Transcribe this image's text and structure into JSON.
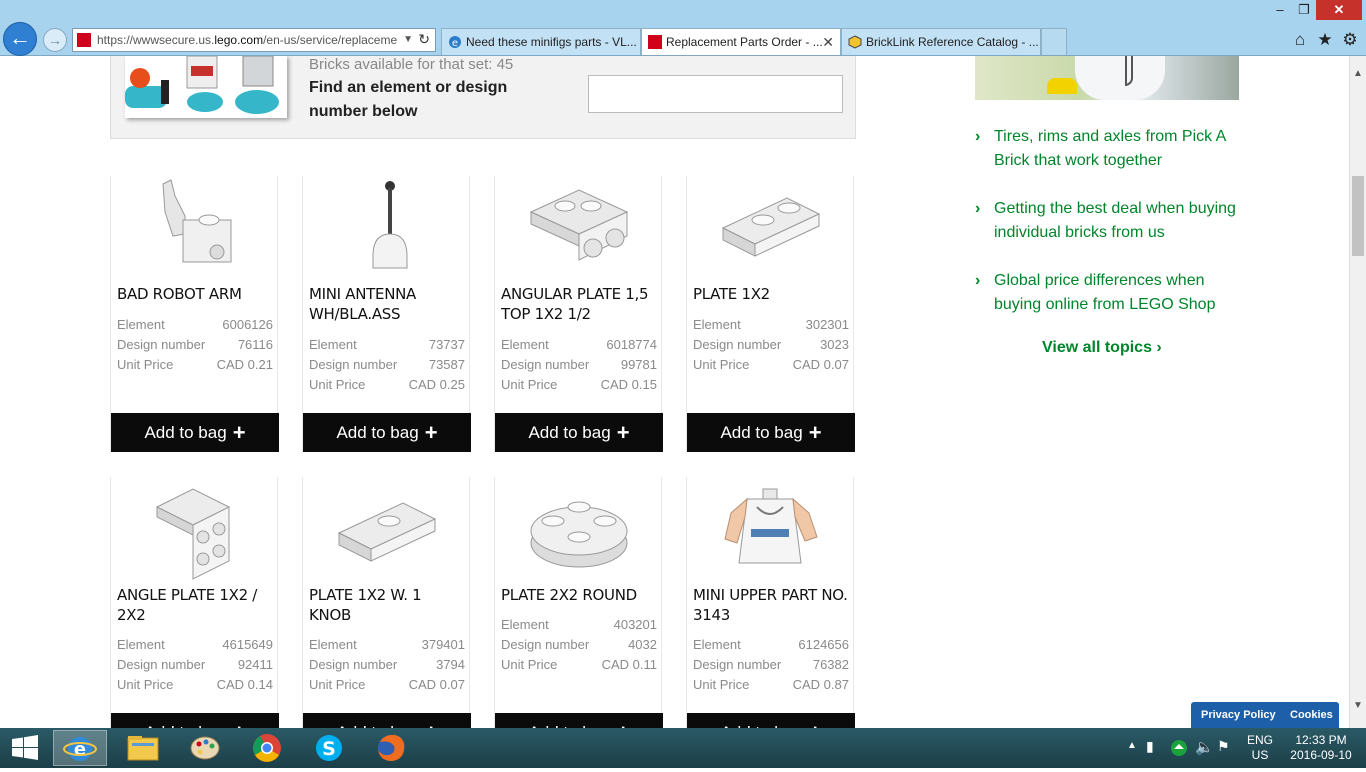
{
  "browser": {
    "url_prefix": "https://wwwsecure.us.",
    "url_domain": "lego.com",
    "url_rest": "/en-us/service/replaceme",
    "tabs": [
      {
        "title": "Need these minifigs parts - VL..."
      },
      {
        "title": "Replacement Parts Order - ..."
      },
      {
        "title": "BrickLink Reference Catalog - ..."
      }
    ]
  },
  "search": {
    "bricks_available": "Bricks available for that set: 45",
    "find_label": "Find an element or design number below",
    "input_value": ""
  },
  "labels": {
    "element": "Element",
    "design_number": "Design number",
    "unit_price": "Unit Price",
    "add_to_bag": "Add to bag"
  },
  "parts": [
    {
      "name": "BAD ROBOT ARM",
      "element": "6006126",
      "design": "76116",
      "price": "CAD 0.21"
    },
    {
      "name": "MINI ANTENNA WH/BLA.ASS",
      "element": "73737",
      "design": "73587",
      "price": "CAD 0.25"
    },
    {
      "name": "ANGULAR PLATE 1,5 TOP 1X2 1/2",
      "element": "6018774",
      "design": "99781",
      "price": "CAD 0.15"
    },
    {
      "name": "PLATE 1X2",
      "element": "302301",
      "design": "3023",
      "price": "CAD 0.07"
    },
    {
      "name": "ANGLE PLATE 1X2 / 2X2",
      "element": "4615649",
      "design": "92411",
      "price": "CAD 0.14"
    },
    {
      "name": "PLATE 1X2 W. 1 KNOB",
      "element": "379401",
      "design": "3794",
      "price": "CAD 0.07"
    },
    {
      "name": "PLATE 2X2 ROUND",
      "element": "403201",
      "design": "4032",
      "price": "CAD 0.11"
    },
    {
      "name": "MINI UPPER PART NO. 3143",
      "element": "6124656",
      "design": "76382",
      "price": "CAD 0.87"
    }
  ],
  "sidebar": {
    "topics": [
      {
        "title": "Tires, rims and axles from Pick A Brick that work together"
      },
      {
        "title": "Getting the best deal when buying individual bricks from us"
      },
      {
        "title": "Global price differences when buying online from LEGO Shop"
      }
    ],
    "view_all": "View all topics"
  },
  "cookie_bar": {
    "privacy": "Privacy Policy",
    "cookies": "Cookies"
  },
  "taskbar": {
    "lang_top": "ENG",
    "lang_bottom": "US",
    "time": "12:33 PM",
    "date": "2016-09-10"
  },
  "colors": {
    "lego_red": "#d0021b",
    "topic_green": "#00852b",
    "button_black": "#0b0b0b",
    "cookie_blue": "#1d5fa8"
  }
}
